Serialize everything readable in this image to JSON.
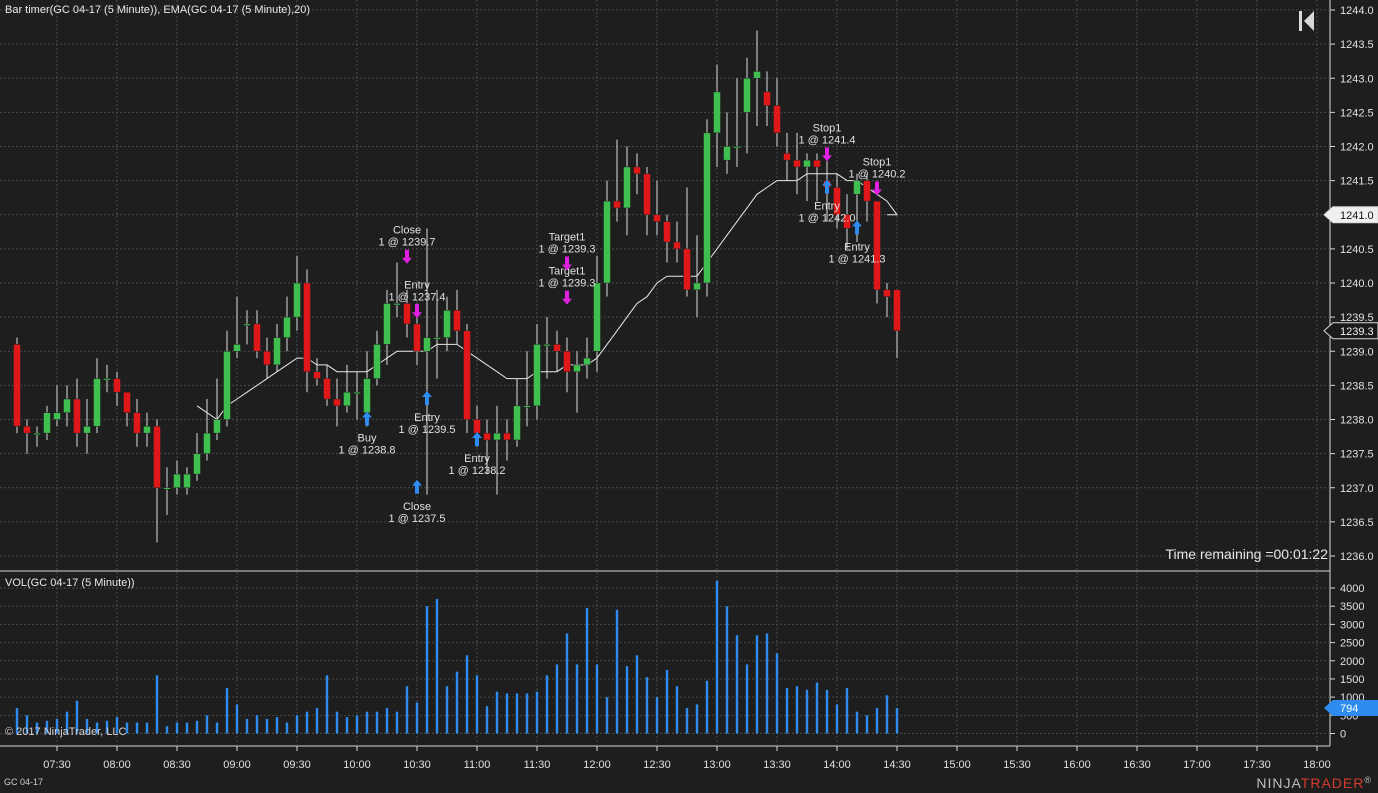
{
  "title": "Bar timer(GC 04-17 (5 Minute)), EMA(GC 04-17 (5 Minute),20)",
  "volume_title": "VOL(GC 04-17 (5 Minute))",
  "copyright": "© 2017 NinjaTrader, LLC",
  "instrument": "GC 04-17",
  "time_remaining": "Time remaining =00:01:22",
  "brand": {
    "left": "NINJA",
    "right": "TRADER",
    "mark": "®"
  },
  "icons": {
    "collapse": "collapse-left-icon",
    "logo": "ninjatrader-logo-icon"
  },
  "colors": {
    "up": "#3fbf4f",
    "down": "#e01818",
    "ema": "#e8e8e8",
    "volume": "#2e8cf0",
    "entry_arrow": "#2e8cf0",
    "exit_arrow": "#e020e0",
    "grid": "#4a4a4a",
    "background": "#1e1e1e"
  },
  "chart_data": [
    {
      "type": "candlestick",
      "interval": "5 Minute",
      "x_tick_labels": [
        "07:30",
        "08:00",
        "08:30",
        "09:00",
        "09:30",
        "10:00",
        "10:30",
        "11:00",
        "11:30",
        "12:00",
        "12:30",
        "13:00",
        "13:30",
        "14:00",
        "14:30",
        "15:00",
        "15:30",
        "16:00",
        "16:30",
        "17:00",
        "17:30",
        "18:00"
      ],
      "y_tick_labels": [
        "1244.0",
        "1243.5",
        "1243.0",
        "1242.5",
        "1242.0",
        "1241.5",
        "1241.0",
        "1240.5",
        "1240.0",
        "1239.5",
        "1239.0",
        "1238.5",
        "1238.0",
        "1237.5",
        "1237.0",
        "1236.5",
        "1236.0"
      ],
      "ylim": [
        1235.8,
        1244.2
      ],
      "price_markers": [
        {
          "value": "1241.0",
          "label": "1241.0"
        },
        {
          "value": "1239.3",
          "label": "1239.3"
        }
      ],
      "times": [
        "07:10",
        "07:15",
        "07:20",
        "07:25",
        "07:30",
        "07:35",
        "07:40",
        "07:45",
        "07:50",
        "07:55",
        "08:00",
        "08:05",
        "08:10",
        "08:15",
        "08:20",
        "08:25",
        "08:30",
        "08:35",
        "08:40",
        "08:45",
        "08:50",
        "08:55",
        "09:00",
        "09:05",
        "09:10",
        "09:15",
        "09:20",
        "09:25",
        "09:30",
        "09:35",
        "09:40",
        "09:45",
        "09:50",
        "09:55",
        "10:00",
        "10:05",
        "10:10",
        "10:15",
        "10:20",
        "10:25",
        "10:30",
        "10:35",
        "10:40",
        "10:45",
        "10:50",
        "10:55",
        "11:00",
        "11:05",
        "11:10",
        "11:15",
        "11:20",
        "11:25",
        "11:30",
        "11:35",
        "11:40",
        "11:45",
        "11:50",
        "11:55",
        "12:00",
        "12:05",
        "12:10",
        "12:15",
        "12:20",
        "12:25",
        "12:30",
        "12:35",
        "12:40",
        "12:45",
        "12:50",
        "12:55",
        "13:00",
        "13:05",
        "13:10",
        "13:15",
        "13:20",
        "13:25",
        "13:30",
        "13:35",
        "13:40",
        "13:45",
        "13:50",
        "13:55",
        "14:00",
        "14:05",
        "14:10",
        "14:15",
        "14:20",
        "14:25",
        "14:30"
      ],
      "open": [
        1239.1,
        1237.9,
        1237.8,
        1237.8,
        1238.0,
        1238.1,
        1238.3,
        1237.8,
        1237.9,
        1238.6,
        1238.6,
        1238.4,
        1238.1,
        1237.8,
        1237.9,
        1237.0,
        1237.0,
        1237.0,
        1237.2,
        1237.5,
        1237.8,
        1238.0,
        1239.0,
        1239.4,
        1239.4,
        1239.0,
        1238.8,
        1239.2,
        1239.5,
        1240.0,
        1238.7,
        1238.6,
        1238.3,
        1238.2,
        1238.4,
        1238.1,
        1238.6,
        1239.1,
        1239.7,
        1239.7,
        1239.4,
        1239.0,
        1239.2,
        1239.2,
        1239.6,
        1239.3,
        1238.0,
        1237.8,
        1237.7,
        1237.8,
        1237.7,
        1238.2,
        1238.2,
        1239.1,
        1239.1,
        1239.0,
        1238.7,
        1238.8,
        1239.0,
        1240.0,
        1241.2,
        1241.1,
        1241.7,
        1241.6,
        1241.0,
        1240.9,
        1240.6,
        1240.5,
        1239.9,
        1240.0,
        1242.2,
        1241.8,
        1242.0,
        1242.5,
        1243.0,
        1242.8,
        1242.6,
        1241.9,
        1241.8,
        1241.7,
        1241.8,
        1241.5,
        1241.4,
        1241.0,
        1241.3,
        1241.5,
        1241.2,
        1239.9,
        1239.9
      ],
      "close": [
        1237.9,
        1237.8,
        1237.8,
        1238.1,
        1238.1,
        1238.3,
        1237.8,
        1237.9,
        1238.6,
        1238.6,
        1238.4,
        1238.1,
        1237.8,
        1237.9,
        1237.0,
        1237.0,
        1237.2,
        1237.2,
        1237.5,
        1237.8,
        1238.0,
        1239.0,
        1239.1,
        1239.4,
        1239.0,
        1238.8,
        1239.2,
        1239.5,
        1240.0,
        1238.7,
        1238.6,
        1238.3,
        1238.2,
        1238.4,
        1238.4,
        1238.6,
        1239.1,
        1239.7,
        1239.7,
        1239.4,
        1239.0,
        1239.2,
        1239.2,
        1239.6,
        1239.3,
        1238.0,
        1237.8,
        1237.7,
        1237.8,
        1237.7,
        1238.2,
        1238.2,
        1239.1,
        1239.1,
        1239.0,
        1238.7,
        1238.8,
        1238.9,
        1240.0,
        1241.2,
        1241.1,
        1241.7,
        1241.6,
        1241.0,
        1240.9,
        1240.6,
        1240.5,
        1239.9,
        1240.0,
        1242.2,
        1242.8,
        1242.0,
        1242.0,
        1243.0,
        1243.1,
        1242.6,
        1242.2,
        1241.8,
        1241.7,
        1241.8,
        1241.7,
        1241.4,
        1241.0,
        1240.8,
        1241.5,
        1241.2,
        1239.9,
        1239.8,
        1239.3
      ],
      "high": [
        1239.2,
        1238.0,
        1237.9,
        1238.2,
        1238.5,
        1238.5,
        1238.6,
        1238.3,
        1238.9,
        1238.8,
        1238.7,
        1238.4,
        1238.3,
        1238.1,
        1238.0,
        1237.3,
        1237.4,
        1237.3,
        1237.8,
        1238.3,
        1238.6,
        1239.3,
        1239.8,
        1239.6,
        1239.6,
        1239.2,
        1239.4,
        1239.8,
        1240.4,
        1240.2,
        1238.9,
        1238.8,
        1238.6,
        1238.8,
        1238.7,
        1239.0,
        1239.3,
        1239.9,
        1240.3,
        1239.9,
        1239.7,
        1240.8,
        1239.9,
        1239.8,
        1239.9,
        1239.4,
        1238.2,
        1238.0,
        1238.2,
        1238.0,
        1238.6,
        1239.0,
        1239.4,
        1239.5,
        1239.3,
        1239.2,
        1239.0,
        1239.2,
        1240.4,
        1241.5,
        1242.1,
        1242.0,
        1241.9,
        1241.7,
        1241.5,
        1241.0,
        1240.9,
        1241.4,
        1240.7,
        1242.4,
        1243.2,
        1242.5,
        1243.0,
        1243.3,
        1243.7,
        1243.1,
        1243.0,
        1242.2,
        1242.2,
        1241.9,
        1241.9,
        1241.8,
        1241.6,
        1241.3,
        1241.6,
        1241.6,
        1241.2,
        1240.0,
        1239.9
      ],
      "low": [
        1237.8,
        1237.5,
        1237.6,
        1237.7,
        1237.9,
        1237.9,
        1237.6,
        1237.5,
        1237.8,
        1238.4,
        1238.2,
        1237.9,
        1237.6,
        1237.6,
        1236.2,
        1236.6,
        1236.9,
        1236.9,
        1237.1,
        1237.4,
        1237.7,
        1237.9,
        1238.9,
        1239.1,
        1238.9,
        1238.6,
        1238.7,
        1239.0,
        1239.3,
        1238.4,
        1238.5,
        1238.2,
        1237.9,
        1238.1,
        1238.0,
        1237.9,
        1238.5,
        1238.8,
        1239.5,
        1239.2,
        1238.8,
        1236.9,
        1238.6,
        1239.0,
        1239.1,
        1237.8,
        1237.6,
        1237.2,
        1236.9,
        1237.4,
        1237.6,
        1237.9,
        1238.0,
        1238.6,
        1238.7,
        1238.4,
        1238.1,
        1238.6,
        1238.7,
        1239.8,
        1240.9,
        1240.7,
        1241.3,
        1240.7,
        1240.7,
        1240.3,
        1240.3,
        1239.8,
        1239.5,
        1239.8,
        1241.7,
        1241.6,
        1241.7,
        1241.9,
        1242.3,
        1242.3,
        1242.0,
        1241.5,
        1241.3,
        1241.2,
        1241.2,
        1240.9,
        1240.8,
        1240.5,
        1240.6,
        1240.9,
        1239.7,
        1239.5,
        1238.9
      ],
      "ema": [
        null,
        null,
        null,
        null,
        null,
        null,
        null,
        null,
        null,
        null,
        null,
        null,
        null,
        null,
        null,
        null,
        null,
        null,
        1238.2,
        1238.1,
        1238.0,
        1238.2,
        1238.3,
        1238.4,
        1238.5,
        1238.6,
        1238.7,
        1238.8,
        1238.9,
        1238.9,
        1238.8,
        1238.8,
        1238.7,
        1238.7,
        1238.7,
        1238.7,
        1238.8,
        1238.9,
        1239.0,
        1239.0,
        1239.0,
        1239.0,
        1239.1,
        1239.1,
        1239.1,
        1239.0,
        1238.9,
        1238.8,
        1238.7,
        1238.6,
        1238.6,
        1238.6,
        1238.7,
        1238.7,
        1238.7,
        1238.8,
        1238.8,
        1238.8,
        1238.9,
        1239.1,
        1239.3,
        1239.5,
        1239.7,
        1239.8,
        1240.0,
        1240.1,
        1240.1,
        1240.1,
        1240.1,
        1240.3,
        1240.5,
        1240.7,
        1240.9,
        1241.1,
        1241.3,
        1241.4,
        1241.5,
        1241.5,
        1241.5,
        1241.6,
        1241.6,
        1241.6,
        1241.6,
        1241.5,
        1241.5,
        1241.4,
        1241.3,
        1241.2,
        1241.0
      ],
      "trade_markers": [
        {
          "time": "10:05",
          "price": 1238.0,
          "type": "buy",
          "label": "Buy",
          "detail": "1 @ 1238.8"
        },
        {
          "time": "10:25",
          "price": 1240.4,
          "type": "sell",
          "label": "Close",
          "detail": "1 @ 1239.7"
        },
        {
          "time": "10:30",
          "price": 1239.6,
          "type": "sell",
          "label": "Entry",
          "detail": "1 @ 1237.4"
        },
        {
          "time": "10:35",
          "price": 1238.3,
          "type": "buy",
          "label": "Entry",
          "detail": "1 @ 1239.5"
        },
        {
          "time": "10:30",
          "price": 1237.0,
          "type": "buy",
          "label": "Close",
          "detail": "1 @ 1237.5"
        },
        {
          "time": "11:00",
          "price": 1237.7,
          "type": "buy",
          "label": "Entry",
          "detail": "1 @ 1238.2"
        },
        {
          "time": "11:45",
          "price": 1239.8,
          "type": "sell",
          "label": "Target1",
          "detail": "1 @ 1239.3"
        },
        {
          "time": "11:45",
          "price": 1240.3,
          "type": "sell",
          "label": "Target1",
          "detail": "1 @ 1239.3"
        },
        {
          "time": "13:55",
          "price": 1241.9,
          "type": "sell",
          "label": "Stop1",
          "detail": "1 @ 1241.4"
        },
        {
          "time": "13:55",
          "price": 1241.4,
          "type": "buy",
          "label": "Entry",
          "detail": "1 @ 1242.0"
        },
        {
          "time": "14:20",
          "price": 1241.4,
          "type": "sell",
          "label": "Stop1",
          "detail": "1 @ 1240.2"
        },
        {
          "time": "14:10",
          "price": 1240.8,
          "type": "buy",
          "label": "Entry",
          "detail": "1 @ 1241.3"
        }
      ]
    },
    {
      "type": "bar",
      "series_name": "VOL(GC 04-17 (5 Minute))",
      "y_tick_labels": [
        "4000",
        "3500",
        "3000",
        "2500",
        "2000",
        "1500",
        "1000",
        "500",
        "0"
      ],
      "ylim": [
        0,
        4200
      ],
      "last_value_label": "794",
      "values": [
        700,
        500,
        300,
        350,
        400,
        600,
        900,
        400,
        300,
        350,
        450,
        300,
        300,
        300,
        1600,
        200,
        300,
        300,
        350,
        500,
        300,
        1250,
        800,
        400,
        500,
        400,
        450,
        300,
        500,
        600,
        700,
        1600,
        600,
        450,
        500,
        600,
        600,
        700,
        600,
        1300,
        850,
        3500,
        3700,
        1300,
        1700,
        2150,
        1600,
        750,
        1150,
        1100,
        1100,
        1100,
        1150,
        1600,
        1900,
        2750,
        1900,
        3450,
        1900,
        1000,
        3400,
        1850,
        2150,
        1550,
        1000,
        1750,
        1300,
        700,
        800,
        1450,
        4200,
        3500,
        2700,
        1900,
        2700,
        2750,
        2200,
        1250,
        1300,
        1200,
        1400,
        1200,
        800,
        1250,
        600,
        500,
        700,
        1050,
        700
      ]
    }
  ]
}
